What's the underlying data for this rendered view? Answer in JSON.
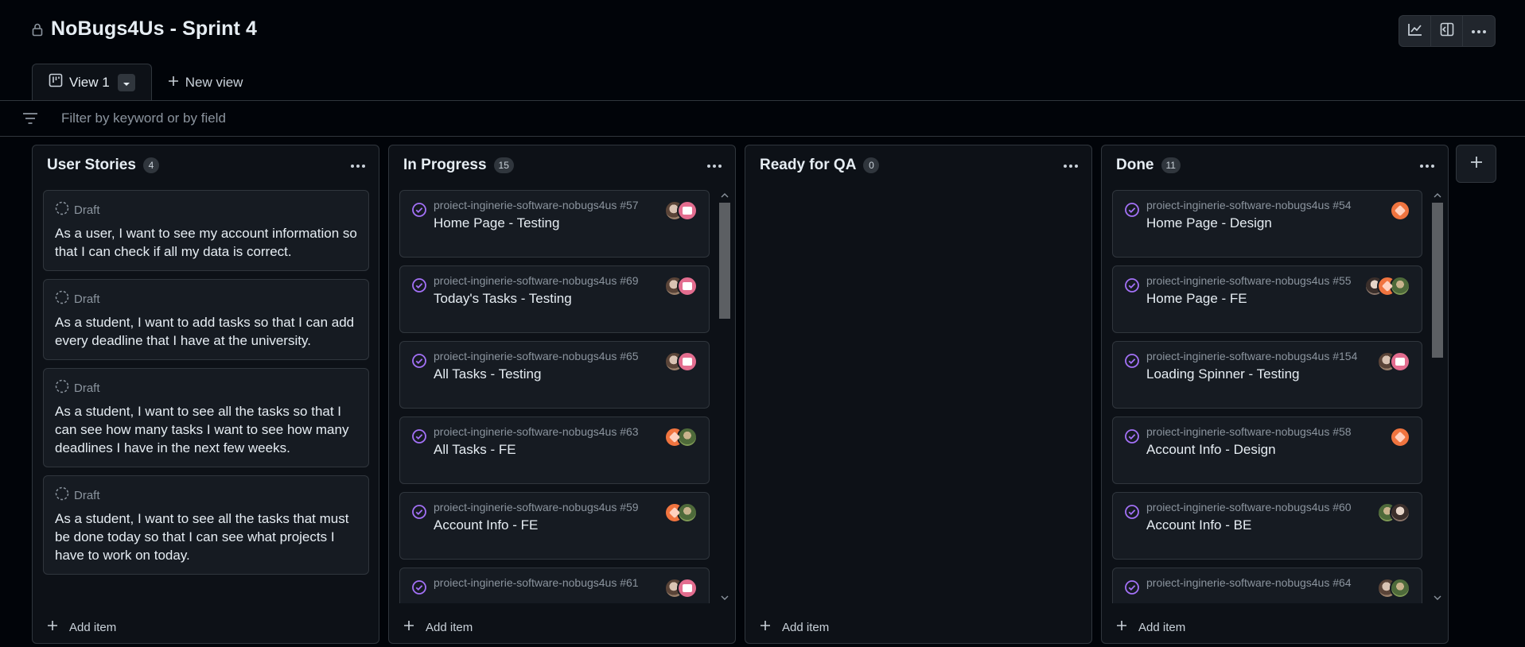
{
  "project": {
    "title": "NoBugs4Us - Sprint 4"
  },
  "icons": {
    "lock": "lock-icon",
    "insights": "graph-icon",
    "side_panel": "sidebar-expand-icon",
    "more": "kebab-horizontal-icon",
    "board_view": "project-board-icon",
    "filter": "filter-icon",
    "plus": "plus-icon",
    "draft": "dashed-circle-icon",
    "issue_done": "circle-check-icon"
  },
  "tabs": [
    {
      "label": "View 1",
      "active": true
    },
    {
      "label": "New view",
      "active": false
    }
  ],
  "filter": {
    "placeholder": "Filter by keyword or by field",
    "value": ""
  },
  "columns": [
    {
      "title": "User Stories",
      "count": "4",
      "add_label": "Add item",
      "cards": [
        {
          "type": "draft",
          "status": "Draft",
          "text": "As a user, I want to see my account information so that I can check if all my data is correct."
        },
        {
          "type": "draft",
          "status": "Draft",
          "text": "As a student, I want to add tasks so that I can add every deadline that I have at the university."
        },
        {
          "type": "draft",
          "status": "Draft",
          "text": "As a student, I want to see all the tasks so that I can see how many tasks I want to see how many deadlines I have in the next few weeks."
        },
        {
          "type": "draft",
          "status": "Draft",
          "text": "As a student, I want to see all the tasks that must be done today so that I can see what projects I have to work on today."
        }
      ]
    },
    {
      "title": "In Progress",
      "count": "15",
      "add_label": "Add item",
      "scroll_fraction": 0.3,
      "cards": [
        {
          "type": "issue",
          "ref": "proiect-inginerie-software-nobugs4us #57",
          "title": "Home Page - Testing"
        },
        {
          "type": "issue",
          "ref": "proiect-inginerie-software-nobugs4us #69",
          "title": "Today's Tasks - Testing"
        },
        {
          "type": "issue",
          "ref": "proiect-inginerie-software-nobugs4us #65",
          "title": "All Tasks - Testing"
        },
        {
          "type": "issue",
          "ref": "proiect-inginerie-software-nobugs4us #63",
          "title": "All Tasks - FE"
        },
        {
          "type": "issue",
          "ref": "proiect-inginerie-software-nobugs4us #59",
          "title": "Account Info - FE"
        },
        {
          "type": "issue",
          "ref": "proiect-inginerie-software-nobugs4us #61",
          "title": ""
        }
      ]
    },
    {
      "title": "Ready for QA",
      "count": "0",
      "add_label": "Add item",
      "cards": []
    },
    {
      "title": "Done",
      "count": "11",
      "add_label": "Add item",
      "scroll_fraction": 0.4,
      "cards": [
        {
          "type": "issue",
          "ref": "proiect-inginerie-software-nobugs4us #54",
          "title": "Home Page - Design"
        },
        {
          "type": "issue",
          "ref": "proiect-inginerie-software-nobugs4us #55",
          "title": "Home Page - FE"
        },
        {
          "type": "issue",
          "ref": "proiect-inginerie-software-nobugs4us #154",
          "title": "Loading Spinner - Testing"
        },
        {
          "type": "issue",
          "ref": "proiect-inginerie-software-nobugs4us #58",
          "title": "Account Info - Design"
        },
        {
          "type": "issue",
          "ref": "proiect-inginerie-software-nobugs4us #60",
          "title": "Account Info - BE"
        },
        {
          "type": "issue",
          "ref": "proiect-inginerie-software-nobugs4us #64",
          "title": ""
        }
      ]
    }
  ],
  "colors": {
    "background": "#010409",
    "column_bg": "#0d1117",
    "card_bg": "#161b22",
    "border": "#30363d",
    "done_icon": "#a371f7",
    "muted_text": "#8b949e"
  }
}
